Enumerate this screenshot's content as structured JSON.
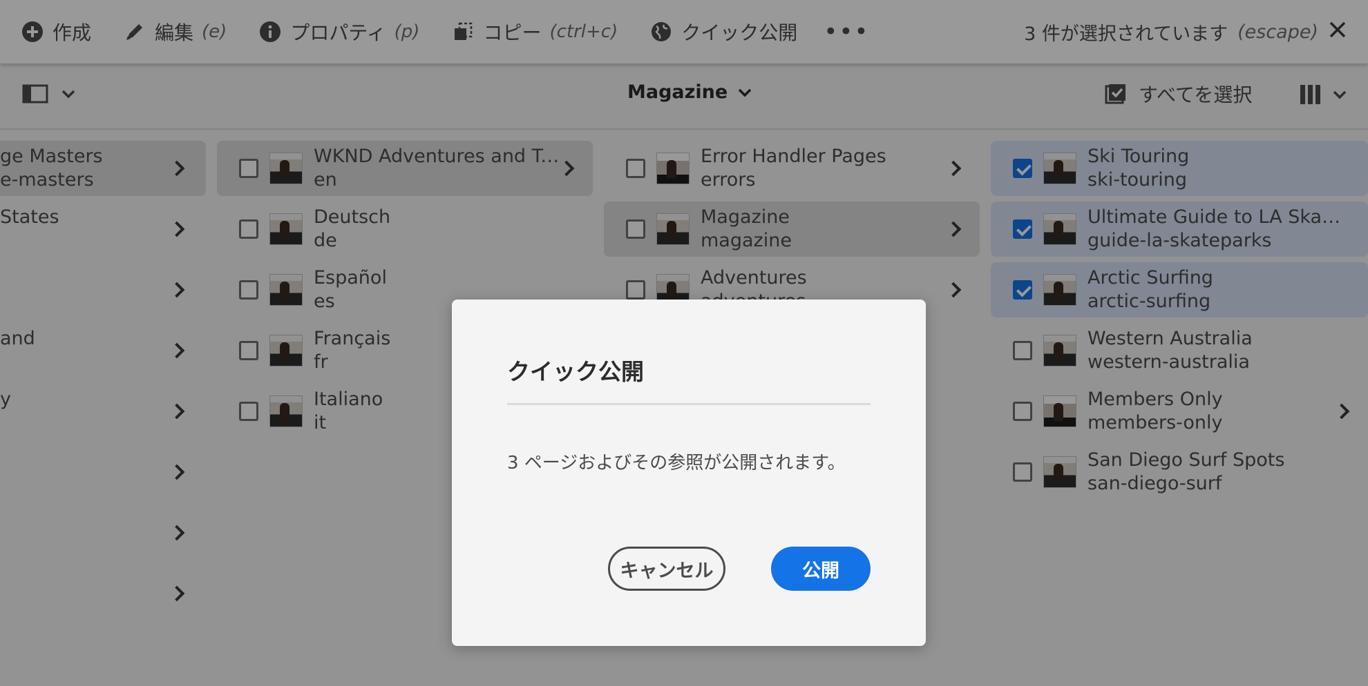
{
  "toolbar": {
    "create": {
      "label": "作成"
    },
    "edit": {
      "label": "編集",
      "hint": "(e)"
    },
    "properties": {
      "label": "プロパティ",
      "hint": "(p)"
    },
    "copy": {
      "label": "コピー",
      "hint": "(ctrl+c)"
    },
    "quick_publish": {
      "label": "クイック公開"
    },
    "more": "•••",
    "selection": {
      "label": "3 件が選択されています",
      "hint": "(escape)"
    }
  },
  "subbar": {
    "breadcrumb": "Magazine",
    "select_all": "すべてを選択"
  },
  "columns": {
    "col1": [
      {
        "title": "ge Masters",
        "name": "e-masters",
        "chevron": true,
        "active": true
      },
      {
        "title": "States",
        "name": "",
        "chevron": true
      },
      {
        "title": "",
        "name": "",
        "chevron": true
      },
      {
        "title": "and",
        "name": "",
        "chevron": true
      },
      {
        "title": "y",
        "name": "",
        "chevron": true
      },
      {
        "title": "",
        "name": "",
        "chevron": true
      },
      {
        "title": "",
        "name": "",
        "chevron": true
      },
      {
        "title": "",
        "name": "",
        "chevron": true
      }
    ],
    "col2": [
      {
        "title": "WKND Adventures and Tr…",
        "name": "en",
        "chevron": true,
        "active": true
      },
      {
        "title": "Deutsch",
        "name": "de"
      },
      {
        "title": "Español",
        "name": "es"
      },
      {
        "title": "Français",
        "name": "fr"
      },
      {
        "title": "Italiano",
        "name": "it"
      }
    ],
    "col3": [
      {
        "title": "Error Handler Pages",
        "name": "errors",
        "chevron": true
      },
      {
        "title": "Magazine",
        "name": "magazine",
        "chevron": true,
        "active": true
      },
      {
        "title": "Adventures",
        "name": "adventures",
        "chevron": true
      }
    ],
    "col4": [
      {
        "title": "Ski Touring",
        "name": "ski-touring",
        "checked": true
      },
      {
        "title": "Ultimate Guide to LA Skat…",
        "name": "guide-la-skateparks",
        "checked": true
      },
      {
        "title": "Arctic Surfing",
        "name": "arctic-surfing",
        "checked": true
      },
      {
        "title": "Western Australia",
        "name": "western-australia",
        "checked": false
      },
      {
        "title": "Members Only",
        "name": "members-only",
        "checked": false,
        "chevron": true
      },
      {
        "title": "San Diego Surf Spots",
        "name": "san-diego-surf",
        "checked": false
      }
    ]
  },
  "dialog": {
    "title": "クイック公開",
    "message": "3 ページおよびその参照が公開されます。",
    "cancel_label": "キャンセル",
    "publish_label": "公開"
  },
  "colors": {
    "accent": "#1473e6",
    "overlay": "rgba(0,0,0,0.4)"
  }
}
